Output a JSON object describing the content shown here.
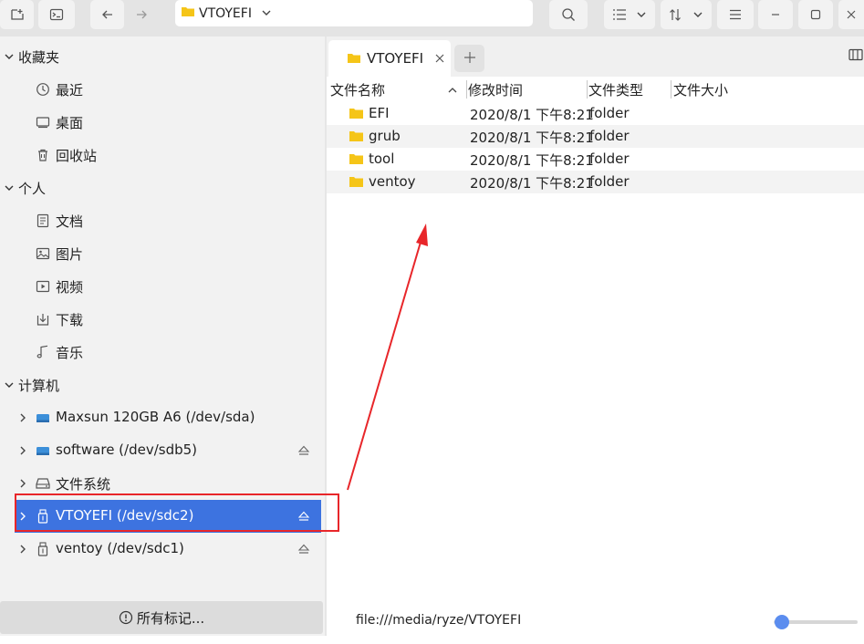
{
  "toolbar": {
    "path": "VTOYEFI",
    "colors": {
      "bg": "#e4e4e4",
      "button": "#f2f2f2"
    }
  },
  "sidebar": {
    "groups": {
      "favorites": "收藏夹",
      "personal": "个人",
      "computer": "计算机"
    },
    "favorites": [
      {
        "label": "最近",
        "icon": "clock-icon"
      },
      {
        "label": "桌面",
        "icon": "desktop-icon"
      },
      {
        "label": "回收站",
        "icon": "trash-icon"
      }
    ],
    "personal": [
      {
        "label": "文档",
        "icon": "document-icon"
      },
      {
        "label": "图片",
        "icon": "image-icon"
      },
      {
        "label": "视频",
        "icon": "video-icon"
      },
      {
        "label": "下载",
        "icon": "download-icon"
      },
      {
        "label": "音乐",
        "icon": "music-icon"
      }
    ],
    "computer": [
      {
        "label": "Maxsun  120GB A6 (/dev/sda)",
        "icon": "drive-icon"
      },
      {
        "label": "software (/dev/sdb5)",
        "icon": "drive-icon"
      },
      {
        "label": "文件系统",
        "icon": "harddisk-icon"
      },
      {
        "label": "VTOYEFI (/dev/sdc2)",
        "icon": "usb-icon",
        "selected": true
      },
      {
        "label": "ventoy (/dev/sdc1)",
        "icon": "usb-icon"
      }
    ],
    "tags_button": "所有标记...",
    "selected_color": "#3d73e0"
  },
  "main": {
    "tab": {
      "label": "VTOYEFI"
    },
    "columns": [
      "文件名称",
      "修改时间",
      "文件类型",
      "文件大小"
    ],
    "rows": [
      {
        "name": "EFI",
        "date": "2020/8/1 下午8:21",
        "type": "folder"
      },
      {
        "name": "grub",
        "date": "2020/8/1 下午8:21",
        "type": "folder"
      },
      {
        "name": "tool",
        "date": "2020/8/1 下午8:21",
        "type": "folder"
      },
      {
        "name": "ventoy",
        "date": "2020/8/1 下午8:21",
        "type": "folder"
      }
    ],
    "status_path": "file:///media/ryze/VTOYEFI",
    "zoom_level": 0.1,
    "folder_color": "#f5c518"
  },
  "annotation": {
    "color": "#e8262a"
  }
}
